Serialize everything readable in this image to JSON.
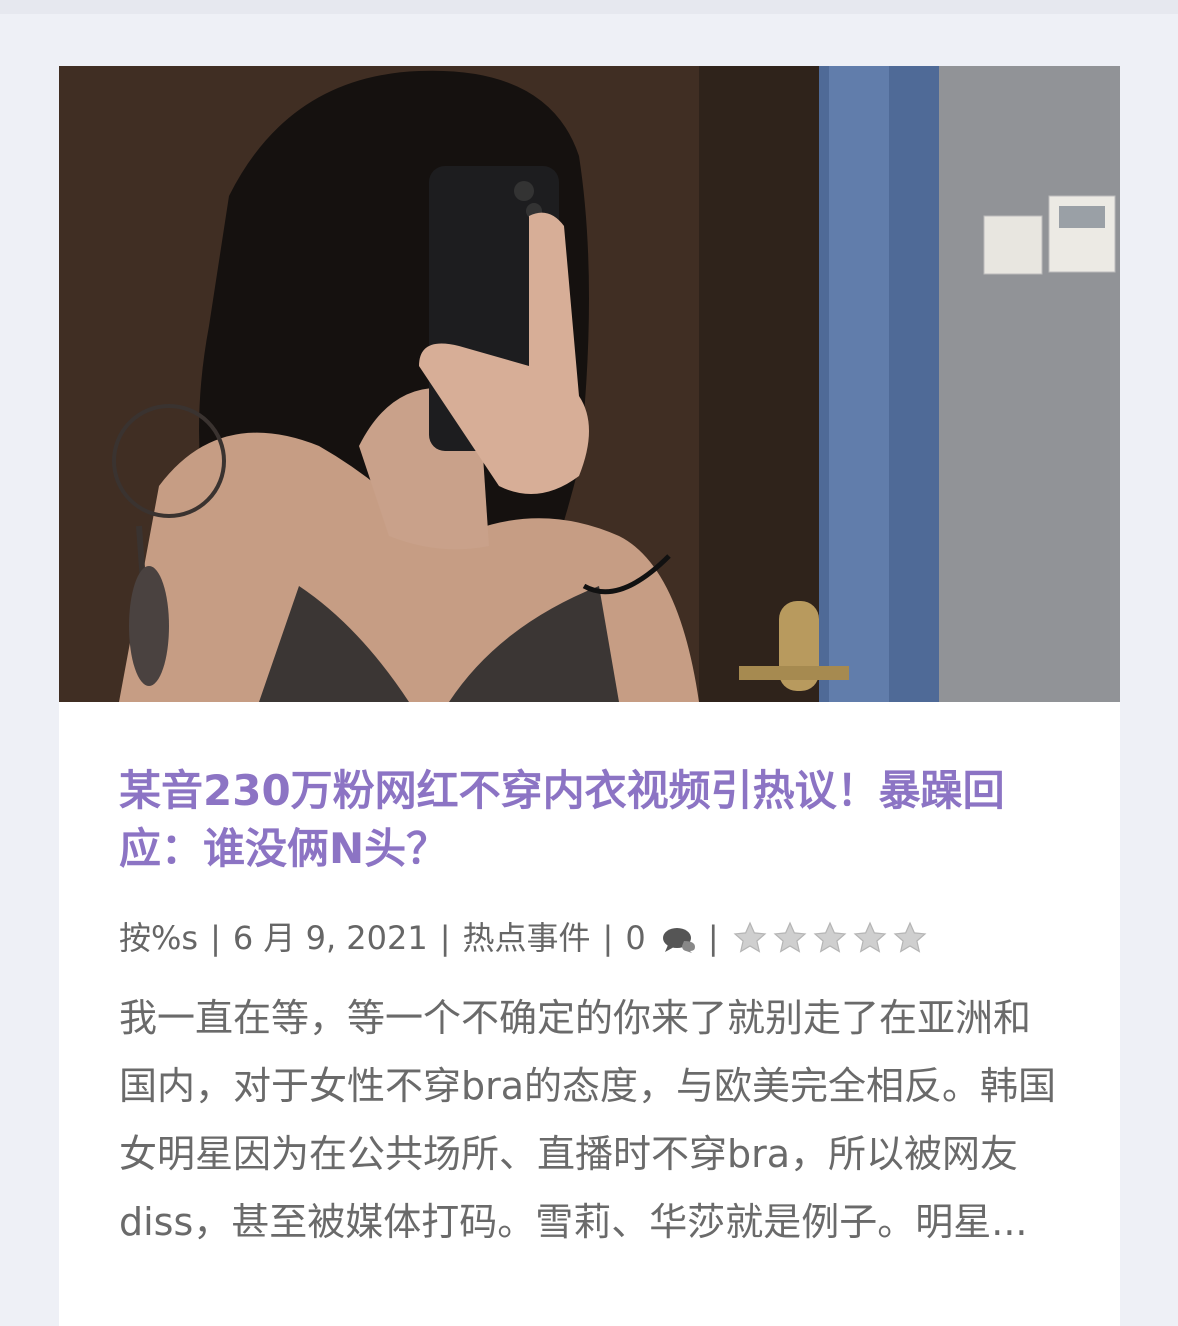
{
  "post": {
    "image_alt": "某音230万粉网红不穿内衣视频引热议！暴躁回应：谁没俩N头？",
    "title": "某音230万粉网红不穿内衣视频引热议！暴躁回应：谁没俩N头？",
    "meta": {
      "author": "按%s",
      "separator": "|",
      "date": "6 月 9, 2021",
      "category": "热点事件",
      "comments": "0",
      "comment_icon": "comment-icon",
      "rating": 0,
      "rating_max": 5
    },
    "excerpt": "我一直在等，等一个不确定的你来了就别走了在亚洲和国内，对于女性不穿bra的态度，与欧美完全相反。韩国女明星因为在公共场所、直播时不穿bra，所以被网友diss，甚至被媒体打码。雪莉、华莎就是例子。明星..."
  },
  "colors": {
    "title": "#8c74c4",
    "meta_text": "#666666",
    "excerpt_text": "#6a6a6a",
    "page_background": "#eef0f6",
    "card_background": "#ffffff",
    "star_empty": "#cfcfcf"
  }
}
